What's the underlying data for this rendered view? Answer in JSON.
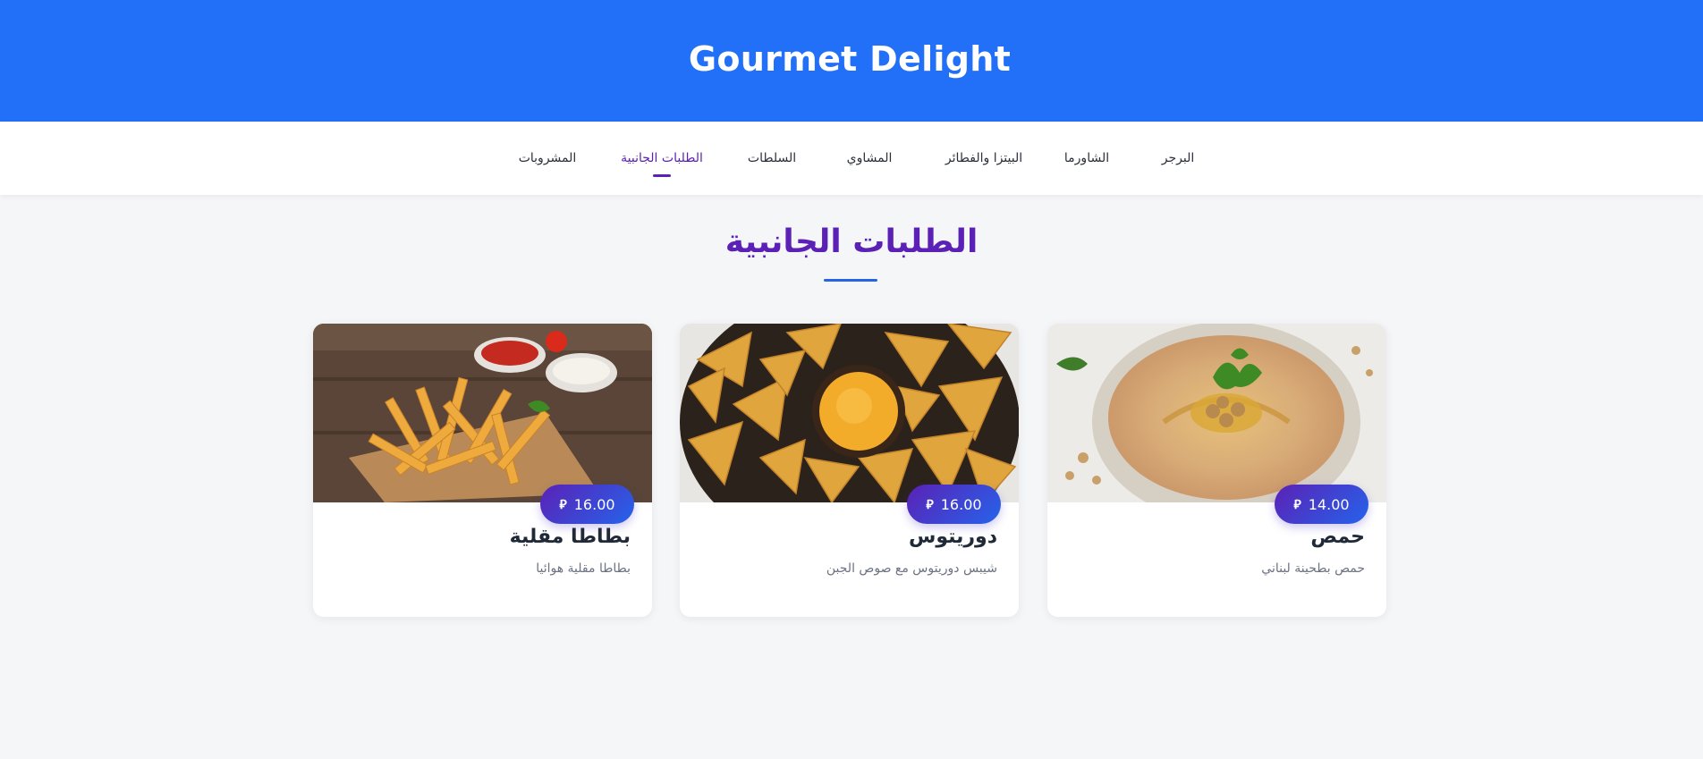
{
  "header": {
    "title": "Gourmet Delight",
    "bg_color": "#2270f7"
  },
  "nav": {
    "items": [
      {
        "label": "البرجر",
        "active": false
      },
      {
        "label": "الشاورما",
        "active": false
      },
      {
        "label": "البيتزا والفطائر",
        "active": false
      },
      {
        "label": "المشاوي",
        "active": false
      },
      {
        "label": "السلطات",
        "active": false
      },
      {
        "label": "الطلبات الجانبية",
        "active": true
      },
      {
        "label": "المشروبات",
        "active": false
      }
    ],
    "active_color": "#5b21b6"
  },
  "section": {
    "title": "الطلبات الجانبية"
  },
  "products": [
    {
      "name": "حمص",
      "description": "حمص بطحينة لبناني",
      "price": "14.00",
      "currency_icon": "saudi-riyal-icon",
      "image": "hummus-image"
    },
    {
      "name": "دوريتوس",
      "description": "شيبس دوريتوس مع صوص الجبن",
      "price": "16.00",
      "currency_icon": "saudi-riyal-icon",
      "image": "doritos-image"
    },
    {
      "name": "بطاطا مقلية",
      "description": "بطاطا مقلية هوائيا",
      "price": "16.00",
      "currency_icon": "saudi-riyal-icon",
      "image": "french-fries-image"
    }
  ],
  "colors": {
    "accent_purple": "#5b21b6",
    "accent_blue": "#2563eb"
  }
}
